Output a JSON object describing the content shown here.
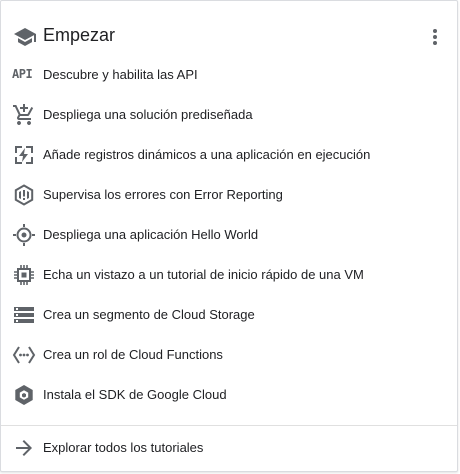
{
  "header": {
    "title": "Empezar",
    "icon": "school-icon",
    "more_icon": "more-vert-icon"
  },
  "items": [
    {
      "icon": "api-icon",
      "icon_text": "API",
      "label": "Descubre y habilita las API"
    },
    {
      "icon": "cart-icon",
      "label": "Despliega una solución prediseñada"
    },
    {
      "icon": "debugger-icon",
      "label": "Añade registros dinámicos a una aplicación en ejecución"
    },
    {
      "icon": "error-reporting-icon",
      "label": "Supervisa los errores con Error Reporting"
    },
    {
      "icon": "target-icon",
      "label": "Despliega una aplicación Hello World"
    },
    {
      "icon": "chip-icon",
      "label": "Echa un vistazo a un tutorial de inicio rápido de una VM"
    },
    {
      "icon": "storage-icon",
      "label": "Crea un segmento de Cloud Storage"
    },
    {
      "icon": "functions-icon",
      "label": "Crea un rol de Cloud Functions"
    },
    {
      "icon": "cloud-sdk-icon",
      "label": "Instala el SDK de Google Cloud"
    }
  ],
  "footer": {
    "icon": "arrow-right-icon",
    "label": "Explorar todos los tutoriales"
  },
  "colors": {
    "icon": "#5f6368",
    "text": "#202124",
    "border": "#dadce0"
  }
}
